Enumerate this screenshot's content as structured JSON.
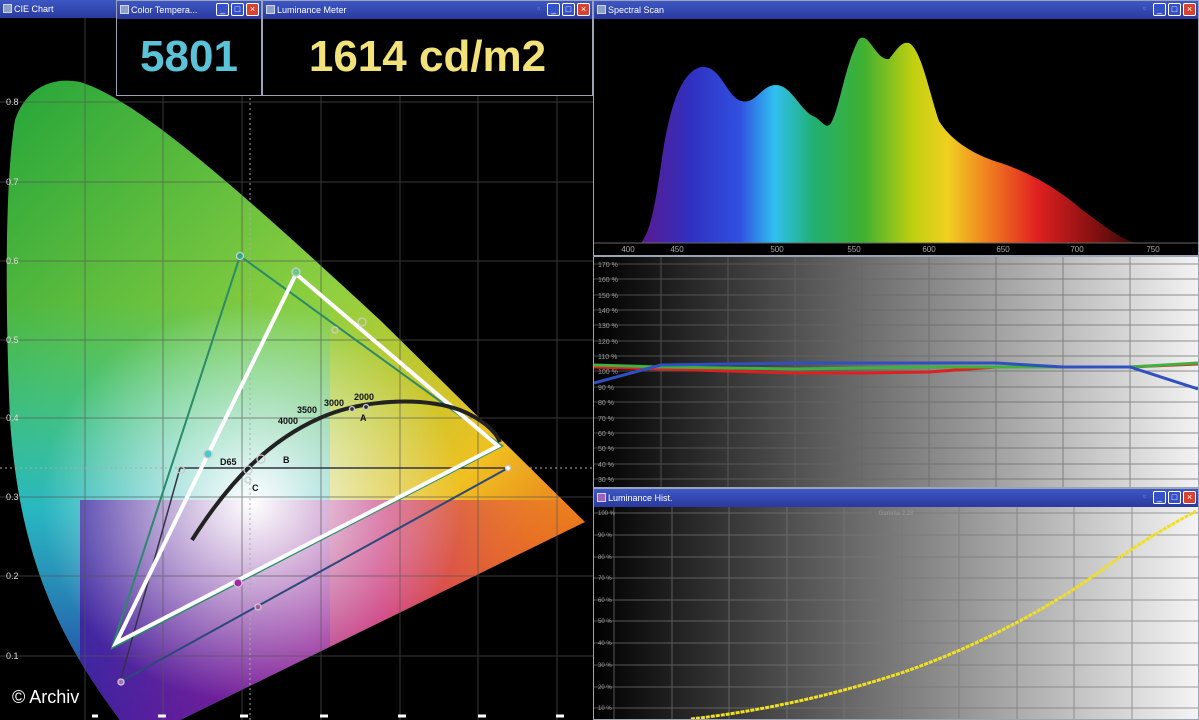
{
  "windows": {
    "cie_chart": {
      "title": "CIE Chart"
    },
    "color_temperature": {
      "title": "Color Tempera...",
      "value": "5801"
    },
    "luminance_meter": {
      "title": "Luminance Meter",
      "value": "1614 cd/m2"
    },
    "spectral_scan": {
      "title": "Spectral Scan"
    },
    "luminance_hist": {
      "title": "Luminance Hist.",
      "subtitle": "Gamma 2.28"
    }
  },
  "cie": {
    "y_ticks": [
      "0.8",
      "0.7",
      "0.6",
      "0.5",
      "0.4",
      "0.3",
      "0.2",
      "0.1"
    ],
    "locus_labels": [
      "2000",
      "3000",
      "3500",
      "4000",
      "D65"
    ],
    "illuminant_labels": [
      "A",
      "B",
      "C"
    ]
  },
  "spectral": {
    "x_ticks": [
      "400",
      "450",
      "500",
      "550",
      "600",
      "650",
      "700",
      "750"
    ]
  },
  "balance": {
    "y_ticks": [
      "170 %",
      "160 %",
      "150 %",
      "140 %",
      "130 %",
      "120 %",
      "110 %",
      "100 %",
      "90 %",
      "80 %",
      "70 %",
      "60 %",
      "50 %",
      "40 %",
      "30 %"
    ]
  },
  "luminance": {
    "y_ticks": [
      "100 %",
      "90 %",
      "80 %",
      "70 %",
      "60 %",
      "50 %",
      "40 %",
      "30 %",
      "20 %",
      "10 %"
    ]
  },
  "copyright": "© Archiv",
  "colors": {
    "title_bar": "#2f43b0",
    "temp_value": "#5bc3d8",
    "lum_value": "#f2e27a",
    "gamut_white": "#ffffff"
  }
}
